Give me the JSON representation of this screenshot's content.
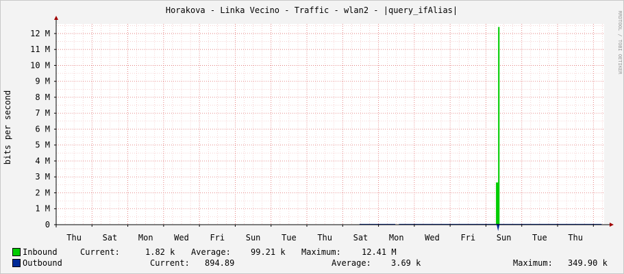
{
  "chart_data": {
    "type": "area",
    "title": "Horakova - Linka Vecino - Traffic - wlan2 - |query_ifAlias|",
    "ylabel": "bits per second",
    "watermark": "RRDTOOL / TOBI OETIKER",
    "yticks": [
      "0",
      "1 M",
      "2 M",
      "3 M",
      "4 M",
      "5 M",
      "6 M",
      "7 M",
      "8 M",
      "9 M",
      "10 M",
      "11 M",
      "12 M"
    ],
    "ylim": [
      0,
      12600000
    ],
    "xlim": [
      0,
      15.3
    ],
    "xtick_labels": [
      "Thu",
      "Sat",
      "Mon",
      "Wed",
      "Fri",
      "Sun",
      "Tue",
      "Thu",
      "Sat",
      "Mon",
      "Wed",
      "Fri",
      "Sun",
      "Tue",
      "Thu"
    ],
    "xtick_positions": [
      0.5,
      1.5,
      2.5,
      3.5,
      4.5,
      5.5,
      6.5,
      7.5,
      8.5,
      9.5,
      10.5,
      11.5,
      12.5,
      13.5,
      14.5
    ],
    "series": [
      {
        "name": "Inbound",
        "color": "#00cc00",
        "points": [
          [
            12.28,
            0
          ],
          [
            12.28,
            2650000
          ],
          [
            12.34,
            2650000
          ],
          [
            12.34,
            12410000
          ],
          [
            12.38,
            12410000
          ],
          [
            12.38,
            0
          ]
        ]
      },
      {
        "name": "Outbound",
        "color": "#002a97",
        "segments": [
          [
            8.47,
            9.47
          ],
          [
            9.57,
            15.23
          ]
        ],
        "spike": [
          [
            12.3,
            0
          ],
          [
            12.34,
            -400000
          ],
          [
            12.38,
            0
          ]
        ]
      }
    ]
  },
  "legend": [
    {
      "name": "Inbound",
      "color": "#00cc00",
      "current_label": "Current:",
      "current": "1.82 k",
      "average_label": "Average:",
      "average": "99.21 k",
      "maximum_label": "Maximum:",
      "maximum": "12.41 M"
    },
    {
      "name": "Outbound",
      "color": "#002a97",
      "current_label": "Current:",
      "current": "894.89",
      "average_label": "Average:",
      "average": "3.69 k",
      "maximum_label": "Maximum:",
      "maximum": "349.90 k"
    }
  ]
}
